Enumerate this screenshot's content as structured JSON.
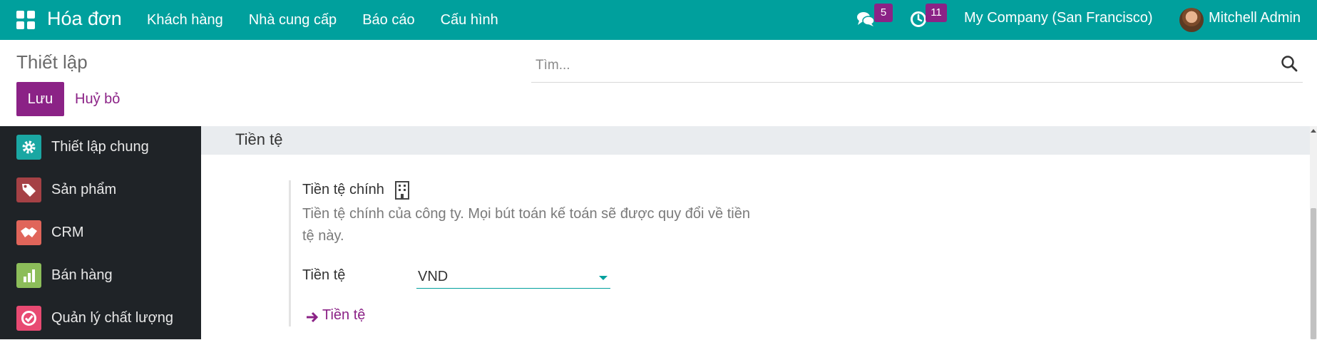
{
  "navbar": {
    "app_title": "Hóa đơn",
    "menu": [
      "Khách hàng",
      "Nhà cung cấp",
      "Báo cáo",
      "Cấu hình"
    ],
    "messages_count": "5",
    "activities_count": "11",
    "company": "My Company (San Francisco)",
    "user": "Mitchell Admin",
    "color": "#00a09d"
  },
  "control_panel": {
    "title": "Thiết lập",
    "search_placeholder": "Tìm...",
    "save_label": "Lưu",
    "cancel_label": "Huỷ bỏ",
    "primary_color": "#8b2286"
  },
  "sidebar": {
    "items": [
      {
        "label": "Thiết lập chung",
        "icon": "gear-icon",
        "color": "#1aa7a3"
      },
      {
        "label": "Sản phẩm",
        "icon": "tags-icon",
        "color": "#a54145"
      },
      {
        "label": "CRM",
        "icon": "handshake-icon",
        "color": "#e0655a"
      },
      {
        "label": "Bán hàng",
        "icon": "sales-chart-icon",
        "color": "#8cbd5a"
      },
      {
        "label": "Quản lý chất lượng",
        "icon": "quality-check-icon",
        "color": "#e84a72"
      }
    ]
  },
  "settings": {
    "section_title": "Tiền tệ",
    "setting_title": "Tiền tệ chính",
    "setting_description": "Tiền tệ chính của công ty. Mọi bút toán kế toán sẽ được quy đổi về tiền tệ này.",
    "field_label": "Tiền tệ",
    "field_value": "VND",
    "link_label": "Tiền tệ"
  }
}
